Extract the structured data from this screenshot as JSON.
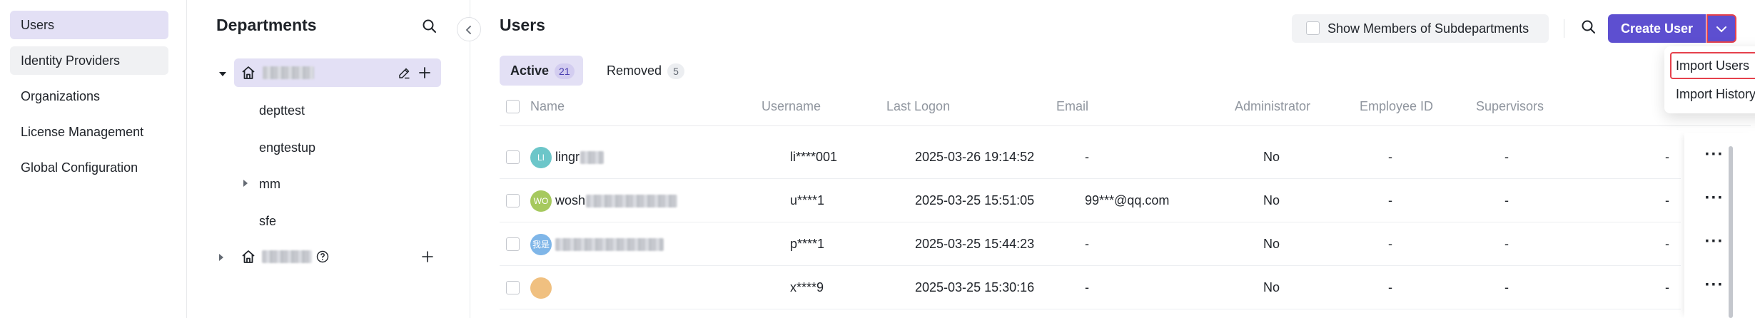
{
  "nav": {
    "items": [
      {
        "label": "Users"
      },
      {
        "label": "Identity Providers"
      },
      {
        "label": "Organizations"
      },
      {
        "label": "License Management"
      },
      {
        "label": "Global Configuration"
      }
    ]
  },
  "departments": {
    "title": "Departments",
    "children": [
      {
        "label": "depttest"
      },
      {
        "label": "engtestup"
      },
      {
        "label": "mm"
      },
      {
        "label": "sfe"
      }
    ]
  },
  "users": {
    "title": "Users",
    "show_subdept_label": "Show Members of Subdepartments",
    "create_button": "Create User",
    "tabs": {
      "active": {
        "label": "Active",
        "count": "21"
      },
      "removed": {
        "label": "Removed",
        "count": "5"
      }
    },
    "columns": {
      "name": "Name",
      "username": "Username",
      "last_logon": "Last Logon",
      "email": "Email",
      "administrator": "Administrator",
      "employee_id": "Employee ID",
      "supervisors": "Supervisors"
    },
    "rows": [
      {
        "avatar_text": "LI",
        "avatar_color": "#6cc6c9",
        "name": "lingr",
        "username": "li****001",
        "last_logon": "2025-03-26 19:14:52",
        "email": "-",
        "administrator": "No",
        "employee_id": "-",
        "supervisors": "-",
        "extra": "-"
      },
      {
        "avatar_text": "WO",
        "avatar_color": "#a6c95e",
        "name": "wosh",
        "username": "u****1",
        "last_logon": "2025-03-25 15:51:05",
        "email": "99***@qq.com",
        "administrator": "No",
        "employee_id": "-",
        "supervisors": "-",
        "extra": "-"
      },
      {
        "avatar_text": "我是",
        "avatar_color": "#7fb6e8",
        "name": "",
        "username": "p****1",
        "last_logon": "2025-03-25 15:44:23",
        "email": "-",
        "administrator": "No",
        "employee_id": "-",
        "supervisors": "-",
        "extra": "-"
      },
      {
        "avatar_text": "",
        "avatar_color": "#f0c080",
        "name": "",
        "username": "x****9",
        "last_logon": "2025-03-25 15:30:16",
        "email": "-",
        "administrator": "No",
        "employee_id": "-",
        "supervisors": "-",
        "extra": "-"
      }
    ],
    "row_action_glyph": "···"
  },
  "create_menu": {
    "items": [
      {
        "label": "Import Users"
      },
      {
        "label": "Import History"
      }
    ]
  },
  "colors": {
    "accent": "#5d4fd0",
    "selected_bg": "#e3e0f5",
    "highlight_outline": "#e5414c"
  },
  "icons": {
    "search": "search-icon",
    "collapse": "chevron-left-icon",
    "home": "home-icon",
    "edit": "edit-icon",
    "add": "plus-icon",
    "info": "info-icon",
    "caret": "caret-icon",
    "dropdown": "chevron-down-icon",
    "more": "more-icon"
  }
}
